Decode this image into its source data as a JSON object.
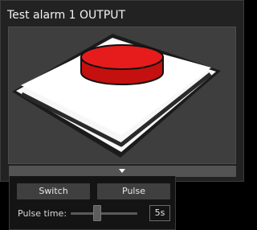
{
  "panel": {
    "title": "Test alarm 1 OUTPUT"
  },
  "preview": {
    "icon": "push-button-icon",
    "button_color": "#e61c1c"
  },
  "controls": {
    "switch_label": "Switch",
    "pulse_label": "Pulse",
    "pulse_time_label": "Pulse time:",
    "pulse_time_value": "5s",
    "pulse_time_slider_fraction": 0.38
  }
}
